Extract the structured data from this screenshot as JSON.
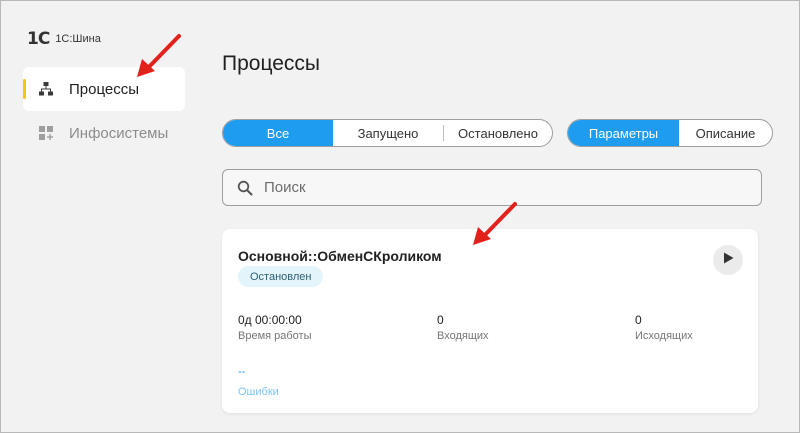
{
  "app": {
    "logo_mark": "1С",
    "title": "1С:Шина"
  },
  "sidebar": {
    "items": [
      {
        "label": "Процессы",
        "icon": "sitemap-icon",
        "active": true
      },
      {
        "label": "Инфосистемы",
        "icon": "apps-add-icon",
        "active": false
      }
    ]
  },
  "main": {
    "title": "Процессы",
    "state_filter": {
      "options": [
        "Все",
        "Запущено",
        "Остановлено"
      ],
      "selected": "Все"
    },
    "view_tabs": {
      "options": [
        "Параметры",
        "Описание"
      ],
      "selected": "Параметры"
    },
    "search": {
      "placeholder": "Поиск",
      "value": ""
    },
    "process_card": {
      "name": "Основной::ОбменСКроликом",
      "status": "Остановлен",
      "metrics": [
        {
          "value": "0д 00:00:00",
          "label": "Время работы"
        },
        {
          "value": "0",
          "label": "Входящих"
        },
        {
          "value": "0",
          "label": "Исходящих"
        }
      ],
      "errors": {
        "value": "--",
        "label": "Ошибки"
      }
    }
  },
  "colors": {
    "accent": "#1e9cf0",
    "active_marker": "#f5c518",
    "badge_bg": "#e3f4fb",
    "annotation_arrow": "#e3201b"
  }
}
